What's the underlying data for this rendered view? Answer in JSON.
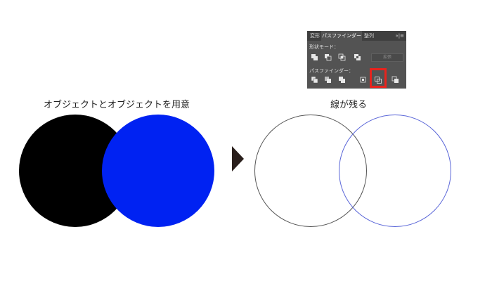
{
  "labels": {
    "left": "オブジェクトとオブジェクトを用意",
    "right": "線が残る"
  },
  "colors": {
    "black_circle": "#000000",
    "blue_circle": "#0022f2",
    "outline_left": "#555555",
    "outline_right": "#5a66d8",
    "arrow": "#2a1f1c",
    "highlight": "#e8231d",
    "panel_bg": "#535353"
  },
  "panel": {
    "tabs": [
      "変形",
      "パスファインダー",
      "整列"
    ],
    "menu_icon": "panel-menu-icon",
    "menu_text": "»|≡",
    "shape_mode_label": "形状モード：",
    "pathfinder_label": "パスファインダー：",
    "expand_label": "拡張",
    "shape_mode_buttons": [
      "unite-icon",
      "minus-front-icon",
      "intersect-icon",
      "exclude-icon"
    ],
    "pathfinder_buttons": [
      "divide-icon",
      "trim-icon",
      "merge-icon",
      "crop-icon",
      "outline-icon",
      "minus-back-icon"
    ]
  }
}
